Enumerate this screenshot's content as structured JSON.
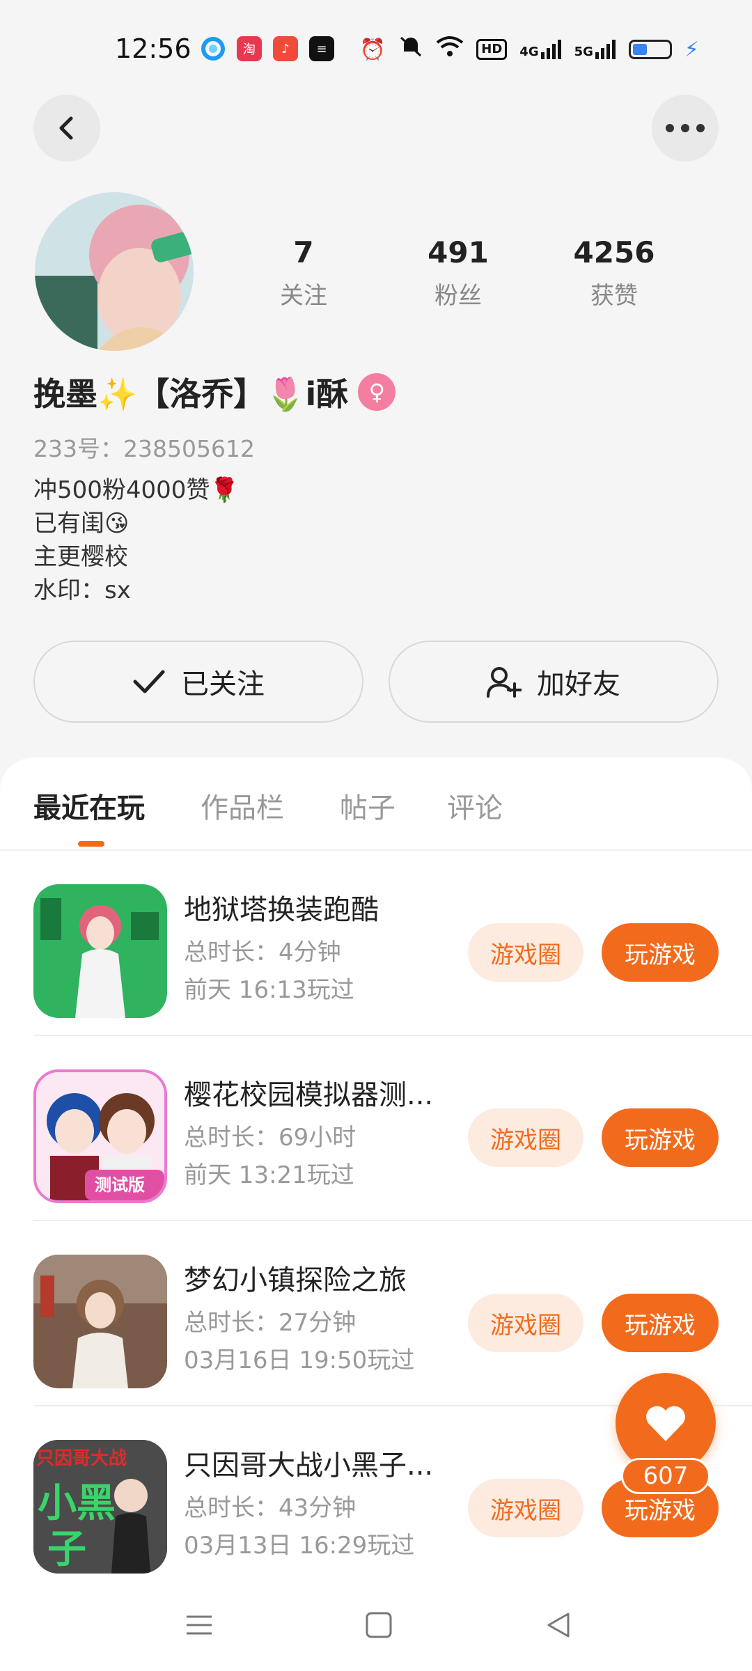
{
  "status_bar": {
    "time": "12:56",
    "notification_icons": [
      "browser-icon",
      "taobao-icon",
      "music-icon",
      "message-icon"
    ],
    "system_icons": [
      "alarm-icon",
      "mute-icon",
      "wifi-icon",
      "hd-icon",
      "4g-signal-icon",
      "5g-signal-icon",
      "battery-icon",
      "charging-icon"
    ],
    "hd_label": "HD",
    "net1": "4G",
    "net2": "5G"
  },
  "header": {
    "back_icon": "chevron-left-icon",
    "more_icon": "more-horizontal-icon"
  },
  "profile": {
    "stats": [
      {
        "num": "7",
        "label": "关注"
      },
      {
        "num": "491",
        "label": "粉丝"
      },
      {
        "num": "4256",
        "label": "获赞"
      }
    ],
    "username": "挽墨✨【洛乔】🌷i酥",
    "gender_symbol": "♀",
    "uid": "233号：238505612",
    "bio": [
      "冲500粉4000赞🌹",
      "已有闺😘",
      "主更樱校",
      "水印：sx"
    ]
  },
  "actions": {
    "follow_label": "已关注",
    "add_friend_label": "加好友"
  },
  "tabs": [
    "最近在玩",
    "作品栏",
    "帖子",
    "评论"
  ],
  "games": [
    {
      "title": "地狱塔换装跑酷",
      "duration": "总时长：4分钟",
      "last_played": "前天 16:13玩过",
      "circle_label": "游戏圈",
      "play_label": "玩游戏"
    },
    {
      "title": "樱花校园模拟器测...",
      "duration": "总时长：69小时",
      "last_played": "前天 13:21玩过",
      "circle_label": "游戏圈",
      "play_label": "玩游戏",
      "icon_text": "测试版"
    },
    {
      "title": "梦幻小镇探险之旅",
      "duration": "总时长：27分钟",
      "last_played": "03月16日 19:50玩过",
      "circle_label": "游戏圈",
      "play_label": "玩游戏"
    },
    {
      "title": "只因哥大战小黑子...",
      "duration": "总时长：43分钟",
      "last_played": "03月13日 16:29玩过",
      "circle_label": "游戏圈",
      "play_label": "玩游戏",
      "icon_text_top": "只因哥大战",
      "icon_text_mid": "小黑",
      "icon_text_bottom": "子"
    }
  ],
  "like_fab": {
    "count": "607"
  },
  "colors": {
    "accent": "#f26b1d",
    "accent_light": "#fdebe0",
    "gender": "#f37ea0"
  }
}
